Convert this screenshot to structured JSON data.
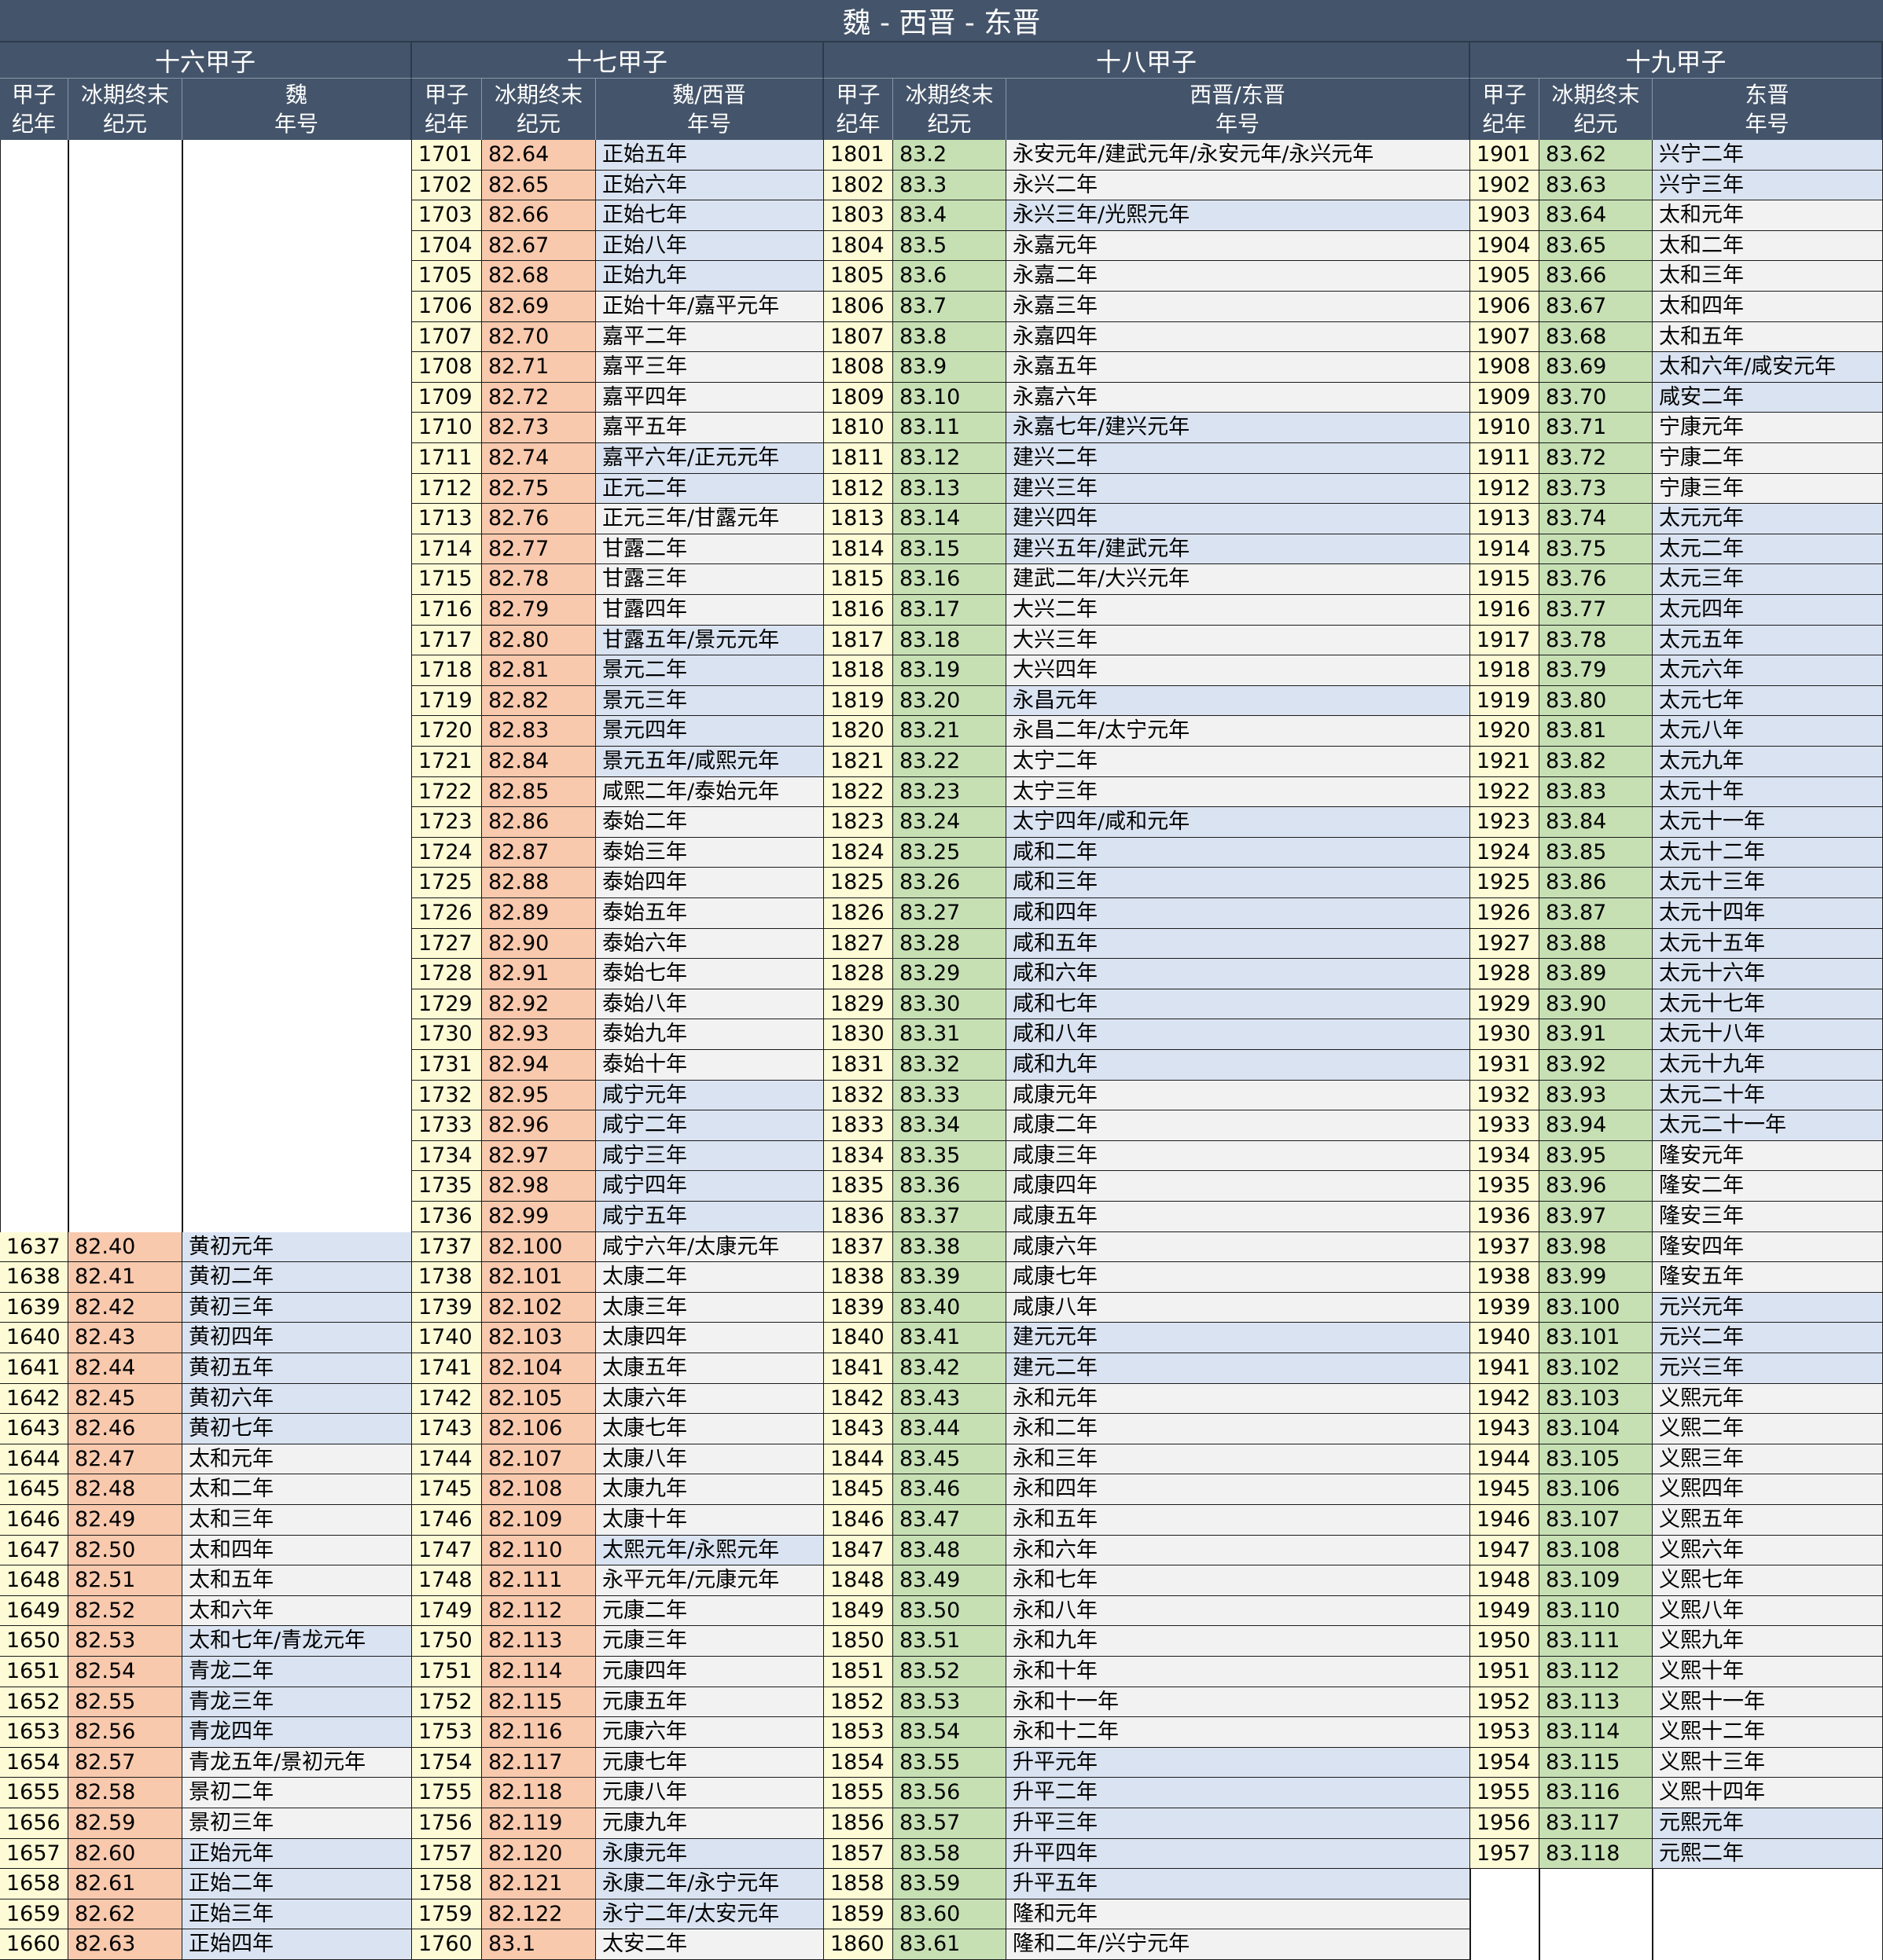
{
  "title": "魏 - 西晋 - 东晋",
  "header_labels": {
    "year_l1": "甲子",
    "year_l2": "纪年",
    "ice_l1": "冰期终末",
    "ice_l2": "纪元",
    "era_l2": "年号"
  },
  "colors": {
    "header": "#44546a",
    "year": "#fdfbd6",
    "ice_wei": "#f8c9ad",
    "ice_dong": "#c6e0b4",
    "era_blue": "#dae3f1",
    "era_grey": "#f2f2f2"
  },
  "groups": [
    {
      "title": "十六甲子",
      "era_l1": "魏",
      "ice_color": "ice_wei",
      "rows": [
        [
          "1637",
          "82.40",
          "黄初元年",
          "b"
        ],
        [
          "1638",
          "82.41",
          "黄初二年",
          "b"
        ],
        [
          "1639",
          "82.42",
          "黄初三年",
          "b"
        ],
        [
          "1640",
          "82.43",
          "黄初四年",
          "b"
        ],
        [
          "1641",
          "82.44",
          "黄初五年",
          "b"
        ],
        [
          "1642",
          "82.45",
          "黄初六年",
          "b"
        ],
        [
          "1643",
          "82.46",
          "黄初七年",
          "b"
        ],
        [
          "1644",
          "82.47",
          "太和元年",
          "g"
        ],
        [
          "1645",
          "82.48",
          "太和二年",
          "g"
        ],
        [
          "1646",
          "82.49",
          "太和三年",
          "g"
        ],
        [
          "1647",
          "82.50",
          "太和四年",
          "g"
        ],
        [
          "1648",
          "82.51",
          "太和五年",
          "g"
        ],
        [
          "1649",
          "82.52",
          "太和六年",
          "g"
        ],
        [
          "1650",
          "82.53",
          "太和七年/青龙元年",
          "b"
        ],
        [
          "1651",
          "82.54",
          "青龙二年",
          "b"
        ],
        [
          "1652",
          "82.55",
          "青龙三年",
          "b"
        ],
        [
          "1653",
          "82.56",
          "青龙四年",
          "b"
        ],
        [
          "1654",
          "82.57",
          "青龙五年/景初元年",
          "g"
        ],
        [
          "1655",
          "82.58",
          "景初二年",
          "g"
        ],
        [
          "1656",
          "82.59",
          "景初三年",
          "g"
        ],
        [
          "1657",
          "82.60",
          "正始元年",
          "b"
        ],
        [
          "1658",
          "82.61",
          "正始二年",
          "b"
        ],
        [
          "1659",
          "82.62",
          "正始三年",
          "b"
        ],
        [
          "1660",
          "82.63",
          "正始四年",
          "b"
        ]
      ]
    },
    {
      "title": "十七甲子",
      "era_l1": "魏/西晋",
      "ice_color": "ice_wei",
      "rows": [
        [
          "1701",
          "82.64",
          "正始五年",
          "b"
        ],
        [
          "1702",
          "82.65",
          "正始六年",
          "b"
        ],
        [
          "1703",
          "82.66",
          "正始七年",
          "b"
        ],
        [
          "1704",
          "82.67",
          "正始八年",
          "b"
        ],
        [
          "1705",
          "82.68",
          "正始九年",
          "b"
        ],
        [
          "1706",
          "82.69",
          "正始十年/嘉平元年",
          "g"
        ],
        [
          "1707",
          "82.70",
          "嘉平二年",
          "g"
        ],
        [
          "1708",
          "82.71",
          "嘉平三年",
          "g"
        ],
        [
          "1709",
          "82.72",
          "嘉平四年",
          "g"
        ],
        [
          "1710",
          "82.73",
          "嘉平五年",
          "g"
        ],
        [
          "1711",
          "82.74",
          "嘉平六年/正元元年",
          "b"
        ],
        [
          "1712",
          "82.75",
          "正元二年",
          "b"
        ],
        [
          "1713",
          "82.76",
          "正元三年/甘露元年",
          "g"
        ],
        [
          "1714",
          "82.77",
          "甘露二年",
          "g"
        ],
        [
          "1715",
          "82.78",
          "甘露三年",
          "g"
        ],
        [
          "1716",
          "82.79",
          "甘露四年",
          "g"
        ],
        [
          "1717",
          "82.80",
          "甘露五年/景元元年",
          "b"
        ],
        [
          "1718",
          "82.81",
          "景元二年",
          "b"
        ],
        [
          "1719",
          "82.82",
          "景元三年",
          "b"
        ],
        [
          "1720",
          "82.83",
          "景元四年",
          "b"
        ],
        [
          "1721",
          "82.84",
          "景元五年/咸熙元年",
          "b"
        ],
        [
          "1722",
          "82.85",
          "咸熙二年/泰始元年",
          "g"
        ],
        [
          "1723",
          "82.86",
          "泰始二年",
          "g"
        ],
        [
          "1724",
          "82.87",
          "泰始三年",
          "g"
        ],
        [
          "1725",
          "82.88",
          "泰始四年",
          "g"
        ],
        [
          "1726",
          "82.89",
          "泰始五年",
          "g"
        ],
        [
          "1727",
          "82.90",
          "泰始六年",
          "g"
        ],
        [
          "1728",
          "82.91",
          "泰始七年",
          "g"
        ],
        [
          "1729",
          "82.92",
          "泰始八年",
          "g"
        ],
        [
          "1730",
          "82.93",
          "泰始九年",
          "g"
        ],
        [
          "1731",
          "82.94",
          "泰始十年",
          "g"
        ],
        [
          "1732",
          "82.95",
          "咸宁元年",
          "b"
        ],
        [
          "1733",
          "82.96",
          "咸宁二年",
          "b"
        ],
        [
          "1734",
          "82.97",
          "咸宁三年",
          "b"
        ],
        [
          "1735",
          "82.98",
          "咸宁四年",
          "b"
        ],
        [
          "1736",
          "82.99",
          "咸宁五年",
          "b"
        ],
        [
          "1737",
          "82.100",
          "咸宁六年/太康元年",
          "g"
        ],
        [
          "1738",
          "82.101",
          "太康二年",
          "g"
        ],
        [
          "1739",
          "82.102",
          "太康三年",
          "g"
        ],
        [
          "1740",
          "82.103",
          "太康四年",
          "g"
        ],
        [
          "1741",
          "82.104",
          "太康五年",
          "g"
        ],
        [
          "1742",
          "82.105",
          "太康六年",
          "g"
        ],
        [
          "1743",
          "82.106",
          "太康七年",
          "g"
        ],
        [
          "1744",
          "82.107",
          "太康八年",
          "g"
        ],
        [
          "1745",
          "82.108",
          "太康九年",
          "g"
        ],
        [
          "1746",
          "82.109",
          "太康十年",
          "g"
        ],
        [
          "1747",
          "82.110",
          "太熙元年/永熙元年",
          "b"
        ],
        [
          "1748",
          "82.111",
          "永平元年/元康元年",
          "g"
        ],
        [
          "1749",
          "82.112",
          "元康二年",
          "g"
        ],
        [
          "1750",
          "82.113",
          "元康三年",
          "g"
        ],
        [
          "1751",
          "82.114",
          "元康四年",
          "g"
        ],
        [
          "1752",
          "82.115",
          "元康五年",
          "g"
        ],
        [
          "1753",
          "82.116",
          "元康六年",
          "g"
        ],
        [
          "1754",
          "82.117",
          "元康七年",
          "g"
        ],
        [
          "1755",
          "82.118",
          "元康八年",
          "g"
        ],
        [
          "1756",
          "82.119",
          "元康九年",
          "g"
        ],
        [
          "1757",
          "82.120",
          "永康元年",
          "b"
        ],
        [
          "1758",
          "82.121",
          "永康二年/永宁元年",
          "b"
        ],
        [
          "1759",
          "82.122",
          "永宁二年/太安元年",
          "b"
        ],
        [
          "1760",
          "83.1",
          "太安二年",
          "g"
        ]
      ]
    },
    {
      "title": "十八甲子",
      "era_l1": "西晋/东晋",
      "ice_color": "ice_dong",
      "rows": [
        [
          "1801",
          "83.2",
          "永安元年/建武元年/永安元年/永兴元年",
          "g"
        ],
        [
          "1802",
          "83.3",
          "永兴二年",
          "g"
        ],
        [
          "1803",
          "83.4",
          "永兴三年/光熙元年",
          "b"
        ],
        [
          "1804",
          "83.5",
          "永嘉元年",
          "g"
        ],
        [
          "1805",
          "83.6",
          "永嘉二年",
          "g"
        ],
        [
          "1806",
          "83.7",
          "永嘉三年",
          "g"
        ],
        [
          "1807",
          "83.8",
          "永嘉四年",
          "g"
        ],
        [
          "1808",
          "83.9",
          "永嘉五年",
          "g"
        ],
        [
          "1809",
          "83.10",
          "永嘉六年",
          "g"
        ],
        [
          "1810",
          "83.11",
          "永嘉七年/建兴元年",
          "b"
        ],
        [
          "1811",
          "83.12",
          "建兴二年",
          "b"
        ],
        [
          "1812",
          "83.13",
          "建兴三年",
          "b"
        ],
        [
          "1813",
          "83.14",
          "建兴四年",
          "b"
        ],
        [
          "1814",
          "83.15",
          "建兴五年/建武元年",
          "b"
        ],
        [
          "1815",
          "83.16",
          "建武二年/大兴元年",
          "g"
        ],
        [
          "1816",
          "83.17",
          "大兴二年",
          "g"
        ],
        [
          "1817",
          "83.18",
          "大兴三年",
          "g"
        ],
        [
          "1818",
          "83.19",
          "大兴四年",
          "g"
        ],
        [
          "1819",
          "83.20",
          "永昌元年",
          "b"
        ],
        [
          "1820",
          "83.21",
          "永昌二年/太宁元年",
          "g"
        ],
        [
          "1821",
          "83.22",
          "太宁二年",
          "g"
        ],
        [
          "1822",
          "83.23",
          "太宁三年",
          "g"
        ],
        [
          "1823",
          "83.24",
          "太宁四年/咸和元年",
          "b"
        ],
        [
          "1824",
          "83.25",
          "咸和二年",
          "b"
        ],
        [
          "1825",
          "83.26",
          "咸和三年",
          "b"
        ],
        [
          "1826",
          "83.27",
          "咸和四年",
          "b"
        ],
        [
          "1827",
          "83.28",
          "咸和五年",
          "b"
        ],
        [
          "1828",
          "83.29",
          "咸和六年",
          "b"
        ],
        [
          "1829",
          "83.30",
          "咸和七年",
          "b"
        ],
        [
          "1830",
          "83.31",
          "咸和八年",
          "b"
        ],
        [
          "1831",
          "83.32",
          "咸和九年",
          "b"
        ],
        [
          "1832",
          "83.33",
          "咸康元年",
          "g"
        ],
        [
          "1833",
          "83.34",
          "咸康二年",
          "g"
        ],
        [
          "1834",
          "83.35",
          "咸康三年",
          "g"
        ],
        [
          "1835",
          "83.36",
          "咸康四年",
          "g"
        ],
        [
          "1836",
          "83.37",
          "咸康五年",
          "g"
        ],
        [
          "1837",
          "83.38",
          "咸康六年",
          "g"
        ],
        [
          "1838",
          "83.39",
          "咸康七年",
          "g"
        ],
        [
          "1839",
          "83.40",
          "咸康八年",
          "g"
        ],
        [
          "1840",
          "83.41",
          "建元元年",
          "b"
        ],
        [
          "1841",
          "83.42",
          "建元二年",
          "b"
        ],
        [
          "1842",
          "83.43",
          "永和元年",
          "g"
        ],
        [
          "1843",
          "83.44",
          "永和二年",
          "g"
        ],
        [
          "1844",
          "83.45",
          "永和三年",
          "g"
        ],
        [
          "1845",
          "83.46",
          "永和四年",
          "g"
        ],
        [
          "1846",
          "83.47",
          "永和五年",
          "g"
        ],
        [
          "1847",
          "83.48",
          "永和六年",
          "g"
        ],
        [
          "1848",
          "83.49",
          "永和七年",
          "g"
        ],
        [
          "1849",
          "83.50",
          "永和八年",
          "g"
        ],
        [
          "1850",
          "83.51",
          "永和九年",
          "g"
        ],
        [
          "1851",
          "83.52",
          "永和十年",
          "g"
        ],
        [
          "1852",
          "83.53",
          "永和十一年",
          "g"
        ],
        [
          "1853",
          "83.54",
          "永和十二年",
          "g"
        ],
        [
          "1854",
          "83.55",
          "升平元年",
          "b"
        ],
        [
          "1855",
          "83.56",
          "升平二年",
          "b"
        ],
        [
          "1856",
          "83.57",
          "升平三年",
          "b"
        ],
        [
          "1857",
          "83.58",
          "升平四年",
          "b"
        ],
        [
          "1858",
          "83.59",
          "升平五年",
          "b"
        ],
        [
          "1859",
          "83.60",
          "隆和元年",
          "g"
        ],
        [
          "1860",
          "83.61",
          "隆和二年/兴宁元年",
          "g"
        ]
      ]
    },
    {
      "title": "十九甲子",
      "era_l1": "东晋",
      "ice_color": "ice_dong",
      "rows": [
        [
          "1901",
          "83.62",
          "兴宁二年",
          "b"
        ],
        [
          "1902",
          "83.63",
          "兴宁三年",
          "b"
        ],
        [
          "1903",
          "83.64",
          "太和元年",
          "g"
        ],
        [
          "1904",
          "83.65",
          "太和二年",
          "g"
        ],
        [
          "1905",
          "83.66",
          "太和三年",
          "g"
        ],
        [
          "1906",
          "83.67",
          "太和四年",
          "g"
        ],
        [
          "1907",
          "83.68",
          "太和五年",
          "g"
        ],
        [
          "1908",
          "83.69",
          "太和六年/咸安元年",
          "b"
        ],
        [
          "1909",
          "83.70",
          "咸安二年",
          "b"
        ],
        [
          "1910",
          "83.71",
          "宁康元年",
          "g"
        ],
        [
          "1911",
          "83.72",
          "宁康二年",
          "g"
        ],
        [
          "1912",
          "83.73",
          "宁康三年",
          "g"
        ],
        [
          "1913",
          "83.74",
          "太元元年",
          "b"
        ],
        [
          "1914",
          "83.75",
          "太元二年",
          "b"
        ],
        [
          "1915",
          "83.76",
          "太元三年",
          "b"
        ],
        [
          "1916",
          "83.77",
          "太元四年",
          "b"
        ],
        [
          "1917",
          "83.78",
          "太元五年",
          "b"
        ],
        [
          "1918",
          "83.79",
          "太元六年",
          "b"
        ],
        [
          "1919",
          "83.80",
          "太元七年",
          "b"
        ],
        [
          "1920",
          "83.81",
          "太元八年",
          "b"
        ],
        [
          "1921",
          "83.82",
          "太元九年",
          "b"
        ],
        [
          "1922",
          "83.83",
          "太元十年",
          "b"
        ],
        [
          "1923",
          "83.84",
          "太元十一年",
          "b"
        ],
        [
          "1924",
          "83.85",
          "太元十二年",
          "b"
        ],
        [
          "1925",
          "83.86",
          "太元十三年",
          "b"
        ],
        [
          "1926",
          "83.87",
          "太元十四年",
          "b"
        ],
        [
          "1927",
          "83.88",
          "太元十五年",
          "b"
        ],
        [
          "1928",
          "83.89",
          "太元十六年",
          "b"
        ],
        [
          "1929",
          "83.90",
          "太元十七年",
          "b"
        ],
        [
          "1930",
          "83.91",
          "太元十八年",
          "b"
        ],
        [
          "1931",
          "83.92",
          "太元十九年",
          "b"
        ],
        [
          "1932",
          "83.93",
          "太元二十年",
          "b"
        ],
        [
          "1933",
          "83.94",
          "太元二十一年",
          "b"
        ],
        [
          "1934",
          "83.95",
          "隆安元年",
          "g"
        ],
        [
          "1935",
          "83.96",
          "隆安二年",
          "g"
        ],
        [
          "1936",
          "83.97",
          "隆安三年",
          "g"
        ],
        [
          "1937",
          "83.98",
          "隆安四年",
          "g"
        ],
        [
          "1938",
          "83.99",
          "隆安五年",
          "g"
        ],
        [
          "1939",
          "83.100",
          "元兴元年",
          "b"
        ],
        [
          "1940",
          "83.101",
          "元兴二年",
          "b"
        ],
        [
          "1941",
          "83.102",
          "元兴三年",
          "b"
        ],
        [
          "1942",
          "83.103",
          "义熙元年",
          "g"
        ],
        [
          "1943",
          "83.104",
          "义熙二年",
          "g"
        ],
        [
          "1944",
          "83.105",
          "义熙三年",
          "g"
        ],
        [
          "1945",
          "83.106",
          "义熙四年",
          "g"
        ],
        [
          "1946",
          "83.107",
          "义熙五年",
          "g"
        ],
        [
          "1947",
          "83.108",
          "义熙六年",
          "g"
        ],
        [
          "1948",
          "83.109",
          "义熙七年",
          "g"
        ],
        [
          "1949",
          "83.110",
          "义熙八年",
          "g"
        ],
        [
          "1950",
          "83.111",
          "义熙九年",
          "g"
        ],
        [
          "1951",
          "83.112",
          "义熙十年",
          "g"
        ],
        [
          "1952",
          "83.113",
          "义熙十一年",
          "g"
        ],
        [
          "1953",
          "83.114",
          "义熙十二年",
          "g"
        ],
        [
          "1954",
          "83.115",
          "义熙十三年",
          "g"
        ],
        [
          "1955",
          "83.116",
          "义熙十四年",
          "g"
        ],
        [
          "1956",
          "83.117",
          "元熙元年",
          "b"
        ],
        [
          "1957",
          "83.118",
          "元熙二年",
          "b"
        ]
      ]
    }
  ]
}
